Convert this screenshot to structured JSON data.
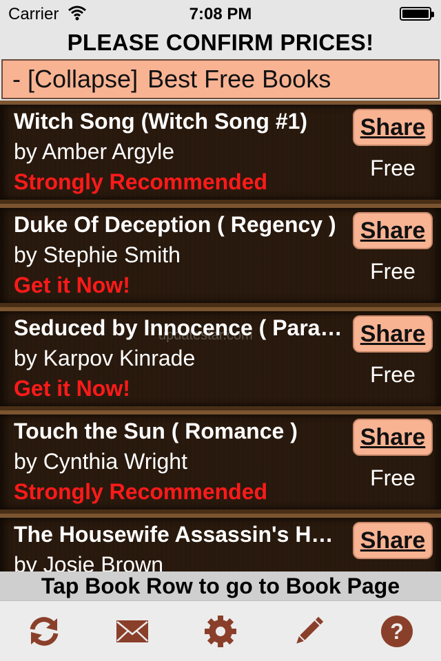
{
  "status": {
    "carrier": "Carrier",
    "time": "7:08 PM"
  },
  "banner": {
    "text": "PLEASE CONFIRM PRICES!"
  },
  "section": {
    "collapse_label": "- [Collapse]",
    "title": "Best Free Books"
  },
  "books": [
    {
      "title": "Witch Song (Witch Song #1)",
      "author": "by Amber Argyle",
      "recommendation": "Strongly Recommended",
      "price": "Free",
      "share": "Share"
    },
    {
      "title": "Duke Of Deception ( Regency )",
      "author": "by Stephie Smith",
      "recommendation": "Get it Now!",
      "price": "Free",
      "share": "Share"
    },
    {
      "title": "Seduced by Innocence ( Paranormal )",
      "author": "by Karpov Kinrade",
      "recommendation": "Get it Now!",
      "price": "Free",
      "share": "Share"
    },
    {
      "title": "Touch the Sun ( Romance )",
      "author": "by Cynthia Wright",
      "recommendation": "Strongly Recommended",
      "price": "Free",
      "share": "Share"
    },
    {
      "title": "The Housewife Assassin's Handbook",
      "author": "by Josie Brown",
      "recommendation": "",
      "price": "",
      "share": "Share"
    }
  ],
  "watermark": "updatestar.com",
  "footer": {
    "hint": "Tap Book Row to go to Book Page"
  },
  "tabbar": {
    "icons": [
      "refresh-icon",
      "mail-icon",
      "settings-gear-icon",
      "pencil-icon",
      "help-icon"
    ]
  },
  "colors": {
    "accent": "#f8b393",
    "recommend_red": "#ff1a1a",
    "icon_brown": "#8a3f2a",
    "row_wood": "#2a1a0e"
  }
}
